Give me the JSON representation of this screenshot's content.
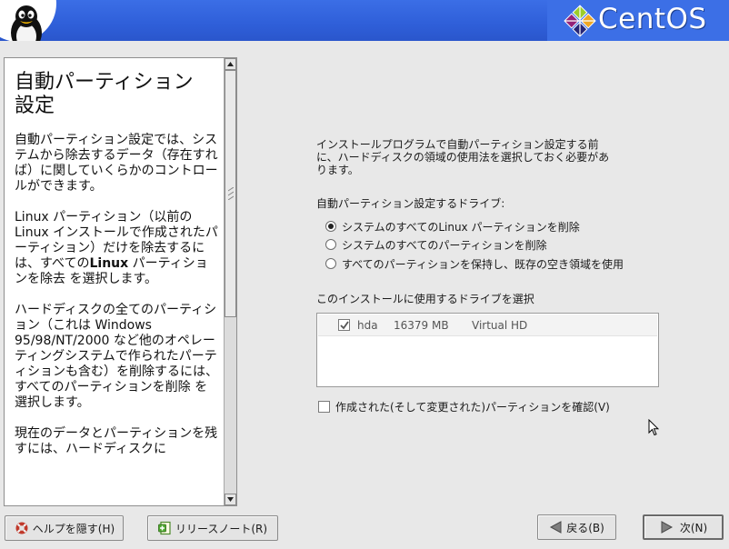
{
  "header": {
    "brand": "CentOS",
    "icons": [
      "tux-penguin-icon",
      "centos-logo-icon"
    ]
  },
  "help": {
    "title_line1": "自動パーティション",
    "title_line2": "設定",
    "p1": "自動パーティション設定では、システムから除去するデータ（存在すれば）に関していくらかのコントロールができます。",
    "p2_before": "Linux パーティション（以前の Linux インストールで作成されたパーティション）だけを除去するには、すべての",
    "p2_bold": "Linux",
    "p2_after": " パーティションを除去 を選択します。",
    "p3": "ハードディスクの全てのパーティション（これは Windows 95/98/NT/2000 など他のオペレーティングシステムで作られたパーティションも含む）を削除するには、 すべてのパーティションを削除 を選択します。",
    "p4": "現在のデータとパーティションを残すには、ハードディスクに"
  },
  "main": {
    "intro": "インストールプログラムで自動パーティション設定する前に、ハードディスクの領域の使用法を選択しておく必要があります。",
    "drive_section_label": "自動パーティション設定するドライブ:",
    "radios": [
      {
        "label": "システムのすべてのLinux パーティションを削除",
        "selected": true
      },
      {
        "label": "システムのすべてのパーティションを削除",
        "selected": false
      },
      {
        "label": "すべてのパーティションを保持し、既存の空き領域を使用",
        "selected": false
      }
    ],
    "drive_list_label": "このインストールに使用するドライブを選択",
    "drives": [
      {
        "name": "hda",
        "size": "16379 MB",
        "model": "Virtual HD",
        "checked": true
      }
    ],
    "review_label": "作成された(そして変更された)パーティションを確認(V)",
    "review_checked": false
  },
  "buttons": {
    "hide_help": "ヘルプを隠す(H)",
    "release_notes": "リリースノート(R)",
    "back": "戻る(B)",
    "next": "次(N)"
  },
  "colors": {
    "header_blue": "#2f5fd9",
    "window_bg": "#e8e8e8"
  }
}
